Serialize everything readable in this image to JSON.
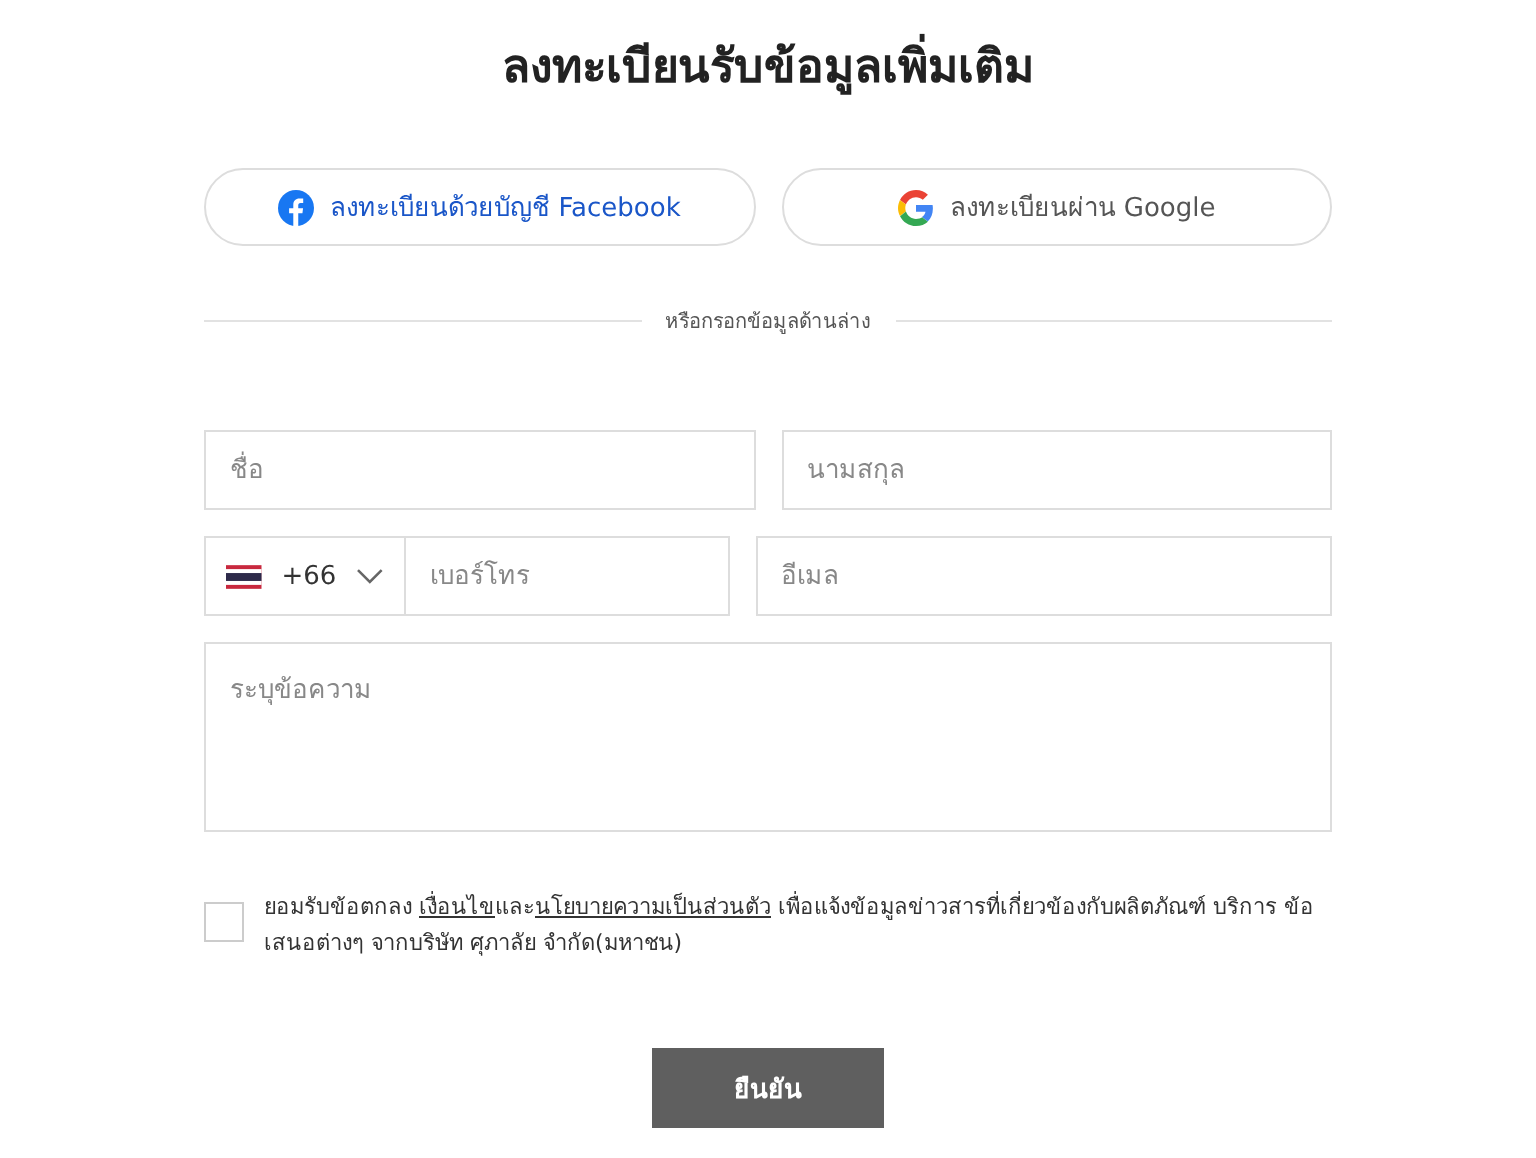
{
  "title": "ลงทะเบียนรับข้อมูลเพิ่มเติม",
  "social_buttons": [
    {
      "kind": "facebook",
      "label": "ลงทะเบียนด้วยบัญชี Facebook"
    },
    {
      "kind": "google",
      "label": "ลงทะเบียนผ่าน Google"
    }
  ],
  "divider_text": "หรือกรอกข้อมูลด้านล่าง",
  "first_name": {
    "placeholder": "ชื่อ"
  },
  "last_name": {
    "placeholder": "นามสกุล"
  },
  "phone": {
    "country_code": "+66",
    "placeholder": "เบอร์โทร"
  },
  "email": {
    "placeholder": "อีเมล"
  },
  "message": {
    "placeholder": "ระบุข้อความ"
  },
  "consent": {
    "checked": false,
    "parts": [
      {
        "kind": "text",
        "text": "ยอมรับข้อตกลง "
      },
      {
        "kind": "link",
        "text": "เงื่อนไข"
      },
      {
        "kind": "text",
        "text": "และ"
      },
      {
        "kind": "link",
        "text": "นโยบายความเป็นส่วนตัว"
      },
      {
        "kind": "text",
        "text": " เพื่อแจ้งข้อมูลข่าวสารที่เกี่ยวข้องกับผลิตภัณฑ์ บริการ ข้อเสนอต่างๆ จากบริษัท ศุภาลัย จำกัด(มหาชน)"
      }
    ]
  },
  "submit": "ยืนยัน"
}
